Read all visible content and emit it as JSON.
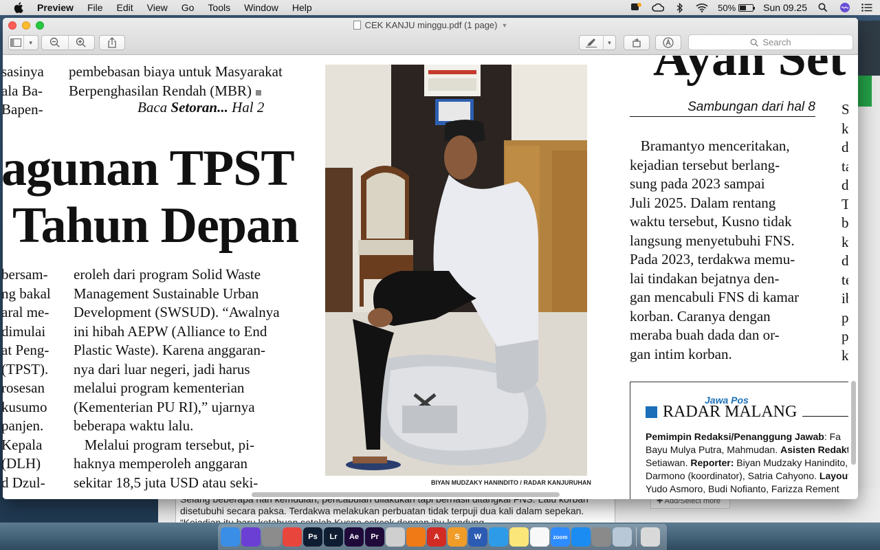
{
  "menubar": {
    "app_name": "Preview",
    "items": [
      "File",
      "Edit",
      "View",
      "Go",
      "Tools",
      "Window",
      "Help"
    ],
    "battery_percent": "50%",
    "clock": "Sun 09.25"
  },
  "window": {
    "title": "CEK KANJU minggu.pdf (1 page)",
    "search_placeholder": "Search"
  },
  "article": {
    "col_a_lines": [
      "sasinya",
      "ala Ba-",
      "Bapen-"
    ],
    "col_b_lines": [
      "pembebasan biaya untuk Masyarakat",
      "Berpenghasilan Rendah (MBR)"
    ],
    "baca_prefix": "Baca ",
    "baca_bold": "Setoran...",
    "baca_suffix": " Hal 2",
    "headline_1": "agunan TPST",
    "headline_2": "Tahun Depan",
    "body_left_lines": [
      "bersam-",
      "ng bakal",
      "aral me-",
      "dimulai",
      "at Peng-",
      "(TPST).",
      "rosesan",
      "kusumo",
      "panjen.",
      "Kepala",
      "(DLH)",
      "d Dzul-"
    ],
    "body_mid_lines": [
      "eroleh dari program Solid Waste",
      "Management Sustainable Urban",
      "Development (SWSUD). “Awalnya",
      "ini hibah AEPW (Alliance to End",
      "Plastic Waste). Karena anggaran-",
      "nya dari luar negeri, jadi harus",
      "melalui program kementerian",
      "(Kementerian PU RI),” ujarnya",
      "beberapa waktu lalu.",
      "   Melalui program tersebut, pi-",
      "haknya memperoleh anggaran",
      "sekitar 18,5 juta USD atau seki-"
    ],
    "photo_caption": "BIYAN MUDZAKY HANINDITO / RADAR KANJURUHAN",
    "right_headline": "Ayan Setu",
    "sambungan": "Sambungan dari hal 8",
    "body_right_lines": [
      "   Bramantyo menceritakan,",
      "kejadian tersebut berlang-",
      "sung pada 2023 sampai",
      "Juli 2025. Dalam rentang",
      "waktu tersebut, Kusno tidak",
      "langsung menyetubuhi FNS.",
      "Pada 2023, terdakwa memu-",
      "lai tindakan bejatnya den-",
      "gan mencabuli FNS di kamar",
      "korban. Caranya dengan",
      "meraba buah dada dan or-",
      "gan intim korban."
    ],
    "far_right_lines": [
      "S",
      "ke",
      "di",
      "ta",
      "di",
      "Te",
      "bu",
      "ka",
      "di",
      "tel",
      "ib",
      "pe",
      "pa",
      "ko"
    ]
  },
  "masthead": {
    "jawapos": "Jawa Pos",
    "radar": "RADAR MALANG",
    "lines": [
      {
        "bold": "Pemimpin Redaksi/Penanggung Jawab",
        "text": ": Fa"
      },
      {
        "bold": "",
        "text": "Bayu Mulya Putra, Mahmudan. "
      },
      {
        "bold": "Asisten Redakt",
        "text": ""
      },
      {
        "bold": "",
        "text": "Setiawan. "
      },
      {
        "bold": "Reporter:",
        "text": " Biyan Mudzaky Hanindito, Ar"
      },
      {
        "bold": "",
        "text": "Darmono (koordinator), Satria Cahyono. "
      },
      {
        "bold": "Layout d",
        "text": ""
      },
      {
        "bold": "",
        "text": "Yudo Asmoro, Budi Nofianto, Farizza Rement"
      }
    ]
  },
  "background_doc": {
    "text": "Selang beberapa hari kemudian, pencabulan dilakukan tapi berhasil ditangkal FNS. Lalu korban disetubuhi secara paksa. Terdakwa melakukan perbuatan tidak terpuji dua kali dalam sepekan. “Kejadian itu baru ketahuan setelah Kusno cekcok dengan ibu kandung",
    "add_button": "Add/Select more"
  },
  "dock": {
    "items": [
      {
        "name": "finder",
        "label": "",
        "color": "#3a8ee6"
      },
      {
        "name": "siri",
        "label": "",
        "color": "#6b3fd4"
      },
      {
        "name": "launchpad",
        "label": "",
        "color": "#8c8c8c"
      },
      {
        "name": "chrome",
        "label": "",
        "color": "#e8453c"
      },
      {
        "name": "photoshop",
        "label": "Ps",
        "color": "#0f1d33"
      },
      {
        "name": "lightroom",
        "label": "Lr",
        "color": "#0f1d33"
      },
      {
        "name": "after-effects",
        "label": "Ae",
        "color": "#1f0a3a"
      },
      {
        "name": "premiere",
        "label": "Pr",
        "color": "#1f0a3a"
      },
      {
        "name": "no-entry",
        "label": "",
        "color": "#cfcfcf"
      },
      {
        "name": "blender",
        "label": "",
        "color": "#f07a16"
      },
      {
        "name": "acrobat",
        "label": "A",
        "color": "#d12b24"
      },
      {
        "name": "sublime",
        "label": "S",
        "color": "#f09c29"
      },
      {
        "name": "word",
        "label": "W",
        "color": "#2b5bb2"
      },
      {
        "name": "safari",
        "label": "",
        "color": "#2d9be8"
      },
      {
        "name": "notes",
        "label": "",
        "color": "#fbe67a"
      },
      {
        "name": "photos",
        "label": "",
        "color": "#f8f8f8"
      },
      {
        "name": "zoom",
        "label": "zoom",
        "color": "#2d8cff"
      },
      {
        "name": "app-store",
        "label": "",
        "color": "#1b8cf2"
      },
      {
        "name": "system-preferences",
        "label": "",
        "color": "#8a8a8a"
      },
      {
        "name": "preview",
        "label": "",
        "color": "#b9c8d6"
      },
      {
        "name": "trash",
        "label": "",
        "color": "#d9d9d9"
      }
    ]
  }
}
